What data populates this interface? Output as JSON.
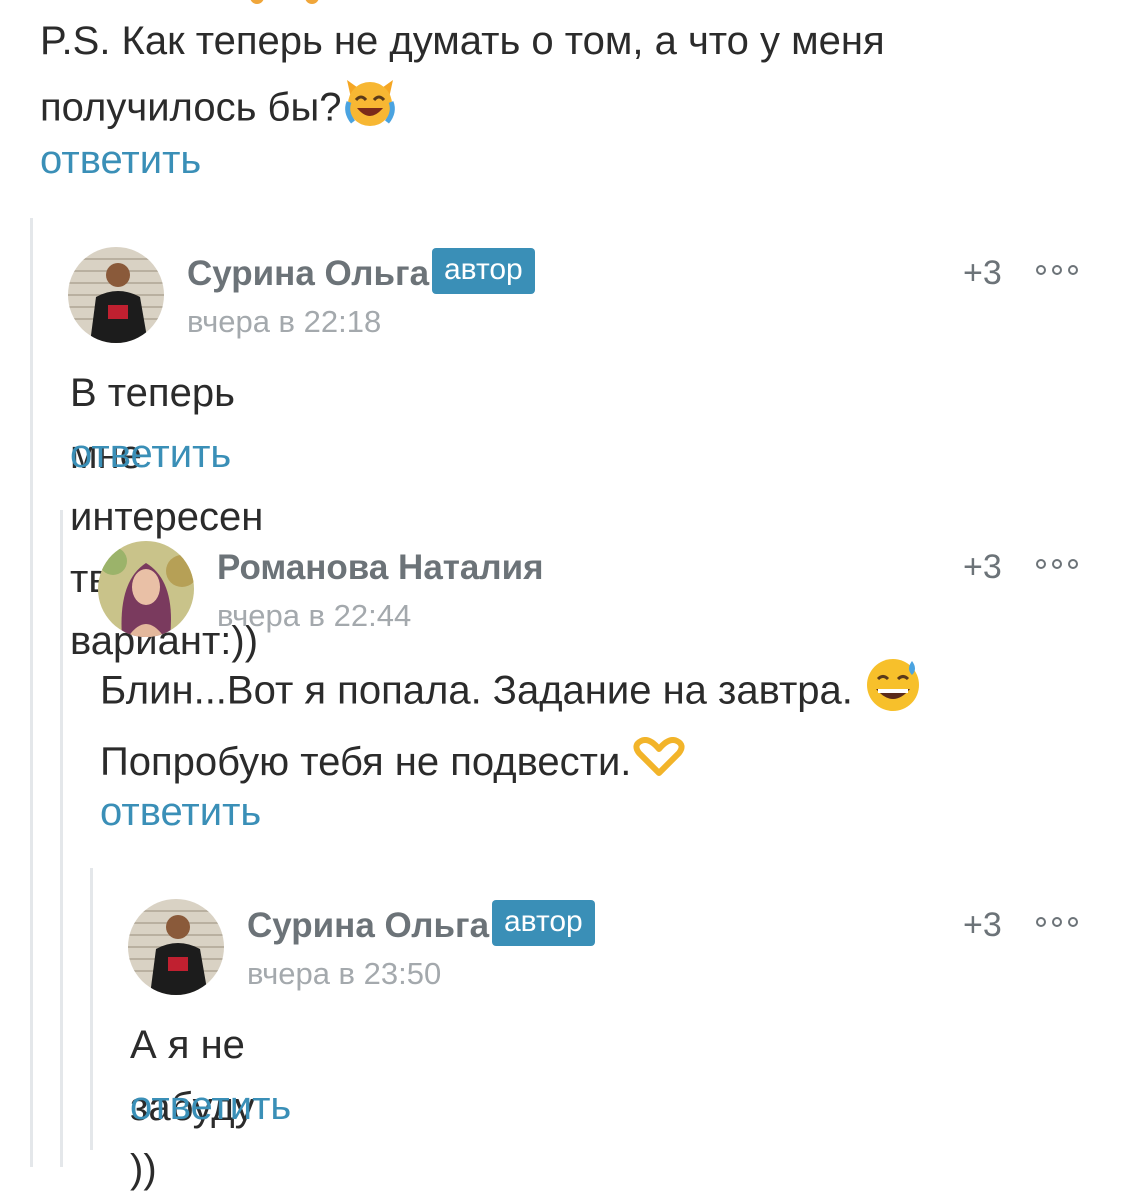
{
  "top_comment": {
    "text": "P.S. Как теперь не думать о том, а что у меня получилось бы?",
    "emoji": "crying-laughing-cat-icon",
    "reply_label": "ответить"
  },
  "comments": [
    {
      "author": "Сурина Ольга",
      "badge": "автор",
      "time": "вчера в 22:18",
      "rating": "+3",
      "text": "В теперь мне интересен твой вариант:))",
      "reply_label": "ответить"
    },
    {
      "author": "Романова Наталия",
      "badge": "",
      "time": "вчера в 22:44",
      "rating": "+3",
      "text_line1": "Блин...Вот я попала. Задание на завтра.",
      "text_line2": "Попробую тебя не подвести.",
      "emojis": [
        "grinning-sweat-icon",
        "heart-hands-icon"
      ],
      "reply_label": "ответить"
    },
    {
      "author": "Сурина Ольга",
      "badge": "автор",
      "time": "вчера в 23:50",
      "rating": "+3",
      "text": "А я не забуду ))",
      "reply_label": "ответить"
    }
  ],
  "colors": {
    "accent": "#3a8fb7",
    "meta": "#a4a9ad",
    "author": "#6c7378",
    "thread_line": "#e4e7ea"
  }
}
